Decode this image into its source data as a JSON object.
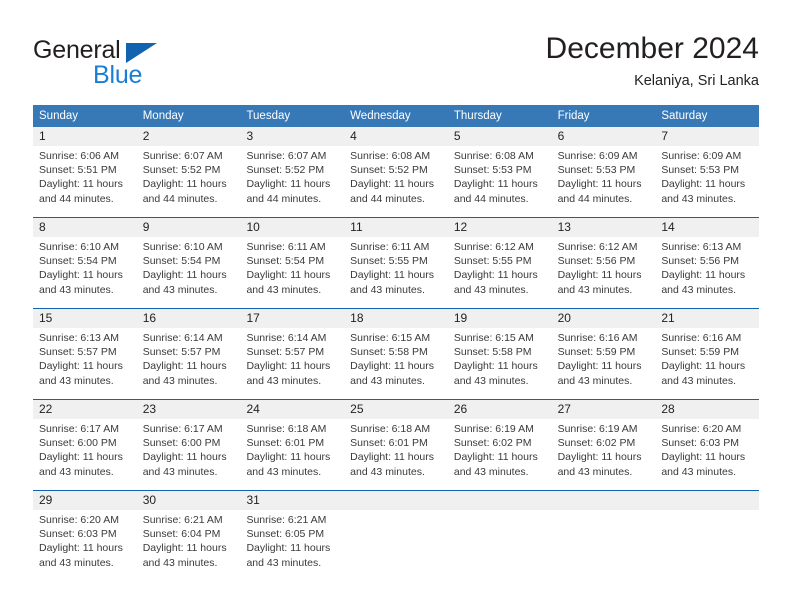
{
  "brand": {
    "name_top": "General",
    "name_bottom": "Blue",
    "accent_color": "#1263af",
    "blue_text_color": "#1a7fd4"
  },
  "header": {
    "title": "December 2024",
    "subtitle": "Kelaniya, Sri Lanka"
  },
  "calendar": {
    "header_bg": "#3778b7",
    "daynum_bg": "#f0f0f0",
    "rule_color": "#1263af",
    "weekdays": [
      "Sunday",
      "Monday",
      "Tuesday",
      "Wednesday",
      "Thursday",
      "Friday",
      "Saturday"
    ],
    "weeks": [
      [
        {
          "day": "1",
          "sunrise": "Sunrise: 6:06 AM",
          "sunset": "Sunset: 5:51 PM",
          "daylight_1": "Daylight: 11 hours",
          "daylight_2": "and 44 minutes."
        },
        {
          "day": "2",
          "sunrise": "Sunrise: 6:07 AM",
          "sunset": "Sunset: 5:52 PM",
          "daylight_1": "Daylight: 11 hours",
          "daylight_2": "and 44 minutes."
        },
        {
          "day": "3",
          "sunrise": "Sunrise: 6:07 AM",
          "sunset": "Sunset: 5:52 PM",
          "daylight_1": "Daylight: 11 hours",
          "daylight_2": "and 44 minutes."
        },
        {
          "day": "4",
          "sunrise": "Sunrise: 6:08 AM",
          "sunset": "Sunset: 5:52 PM",
          "daylight_1": "Daylight: 11 hours",
          "daylight_2": "and 44 minutes."
        },
        {
          "day": "5",
          "sunrise": "Sunrise: 6:08 AM",
          "sunset": "Sunset: 5:53 PM",
          "daylight_1": "Daylight: 11 hours",
          "daylight_2": "and 44 minutes."
        },
        {
          "day": "6",
          "sunrise": "Sunrise: 6:09 AM",
          "sunset": "Sunset: 5:53 PM",
          "daylight_1": "Daylight: 11 hours",
          "daylight_2": "and 44 minutes."
        },
        {
          "day": "7",
          "sunrise": "Sunrise: 6:09 AM",
          "sunset": "Sunset: 5:53 PM",
          "daylight_1": "Daylight: 11 hours",
          "daylight_2": "and 43 minutes."
        }
      ],
      [
        {
          "day": "8",
          "sunrise": "Sunrise: 6:10 AM",
          "sunset": "Sunset: 5:54 PM",
          "daylight_1": "Daylight: 11 hours",
          "daylight_2": "and 43 minutes."
        },
        {
          "day": "9",
          "sunrise": "Sunrise: 6:10 AM",
          "sunset": "Sunset: 5:54 PM",
          "daylight_1": "Daylight: 11 hours",
          "daylight_2": "and 43 minutes."
        },
        {
          "day": "10",
          "sunrise": "Sunrise: 6:11 AM",
          "sunset": "Sunset: 5:54 PM",
          "daylight_1": "Daylight: 11 hours",
          "daylight_2": "and 43 minutes."
        },
        {
          "day": "11",
          "sunrise": "Sunrise: 6:11 AM",
          "sunset": "Sunset: 5:55 PM",
          "daylight_1": "Daylight: 11 hours",
          "daylight_2": "and 43 minutes."
        },
        {
          "day": "12",
          "sunrise": "Sunrise: 6:12 AM",
          "sunset": "Sunset: 5:55 PM",
          "daylight_1": "Daylight: 11 hours",
          "daylight_2": "and 43 minutes."
        },
        {
          "day": "13",
          "sunrise": "Sunrise: 6:12 AM",
          "sunset": "Sunset: 5:56 PM",
          "daylight_1": "Daylight: 11 hours",
          "daylight_2": "and 43 minutes."
        },
        {
          "day": "14",
          "sunrise": "Sunrise: 6:13 AM",
          "sunset": "Sunset: 5:56 PM",
          "daylight_1": "Daylight: 11 hours",
          "daylight_2": "and 43 minutes."
        }
      ],
      [
        {
          "day": "15",
          "sunrise": "Sunrise: 6:13 AM",
          "sunset": "Sunset: 5:57 PM",
          "daylight_1": "Daylight: 11 hours",
          "daylight_2": "and 43 minutes."
        },
        {
          "day": "16",
          "sunrise": "Sunrise: 6:14 AM",
          "sunset": "Sunset: 5:57 PM",
          "daylight_1": "Daylight: 11 hours",
          "daylight_2": "and 43 minutes."
        },
        {
          "day": "17",
          "sunrise": "Sunrise: 6:14 AM",
          "sunset": "Sunset: 5:57 PM",
          "daylight_1": "Daylight: 11 hours",
          "daylight_2": "and 43 minutes."
        },
        {
          "day": "18",
          "sunrise": "Sunrise: 6:15 AM",
          "sunset": "Sunset: 5:58 PM",
          "daylight_1": "Daylight: 11 hours",
          "daylight_2": "and 43 minutes."
        },
        {
          "day": "19",
          "sunrise": "Sunrise: 6:15 AM",
          "sunset": "Sunset: 5:58 PM",
          "daylight_1": "Daylight: 11 hours",
          "daylight_2": "and 43 minutes."
        },
        {
          "day": "20",
          "sunrise": "Sunrise: 6:16 AM",
          "sunset": "Sunset: 5:59 PM",
          "daylight_1": "Daylight: 11 hours",
          "daylight_2": "and 43 minutes."
        },
        {
          "day": "21",
          "sunrise": "Sunrise: 6:16 AM",
          "sunset": "Sunset: 5:59 PM",
          "daylight_1": "Daylight: 11 hours",
          "daylight_2": "and 43 minutes."
        }
      ],
      [
        {
          "day": "22",
          "sunrise": "Sunrise: 6:17 AM",
          "sunset": "Sunset: 6:00 PM",
          "daylight_1": "Daylight: 11 hours",
          "daylight_2": "and 43 minutes."
        },
        {
          "day": "23",
          "sunrise": "Sunrise: 6:17 AM",
          "sunset": "Sunset: 6:00 PM",
          "daylight_1": "Daylight: 11 hours",
          "daylight_2": "and 43 minutes."
        },
        {
          "day": "24",
          "sunrise": "Sunrise: 6:18 AM",
          "sunset": "Sunset: 6:01 PM",
          "daylight_1": "Daylight: 11 hours",
          "daylight_2": "and 43 minutes."
        },
        {
          "day": "25",
          "sunrise": "Sunrise: 6:18 AM",
          "sunset": "Sunset: 6:01 PM",
          "daylight_1": "Daylight: 11 hours",
          "daylight_2": "and 43 minutes."
        },
        {
          "day": "26",
          "sunrise": "Sunrise: 6:19 AM",
          "sunset": "Sunset: 6:02 PM",
          "daylight_1": "Daylight: 11 hours",
          "daylight_2": "and 43 minutes."
        },
        {
          "day": "27",
          "sunrise": "Sunrise: 6:19 AM",
          "sunset": "Sunset: 6:02 PM",
          "daylight_1": "Daylight: 11 hours",
          "daylight_2": "and 43 minutes."
        },
        {
          "day": "28",
          "sunrise": "Sunrise: 6:20 AM",
          "sunset": "Sunset: 6:03 PM",
          "daylight_1": "Daylight: 11 hours",
          "daylight_2": "and 43 minutes."
        }
      ],
      [
        {
          "day": "29",
          "sunrise": "Sunrise: 6:20 AM",
          "sunset": "Sunset: 6:03 PM",
          "daylight_1": "Daylight: 11 hours",
          "daylight_2": "and 43 minutes."
        },
        {
          "day": "30",
          "sunrise": "Sunrise: 6:21 AM",
          "sunset": "Sunset: 6:04 PM",
          "daylight_1": "Daylight: 11 hours",
          "daylight_2": "and 43 minutes."
        },
        {
          "day": "31",
          "sunrise": "Sunrise: 6:21 AM",
          "sunset": "Sunset: 6:05 PM",
          "daylight_1": "Daylight: 11 hours",
          "daylight_2": "and 43 minutes."
        },
        {
          "day": "",
          "sunrise": "",
          "sunset": "",
          "daylight_1": "",
          "daylight_2": ""
        },
        {
          "day": "",
          "sunrise": "",
          "sunset": "",
          "daylight_1": "",
          "daylight_2": ""
        },
        {
          "day": "",
          "sunrise": "",
          "sunset": "",
          "daylight_1": "",
          "daylight_2": ""
        },
        {
          "day": "",
          "sunrise": "",
          "sunset": "",
          "daylight_1": "",
          "daylight_2": ""
        }
      ]
    ]
  }
}
